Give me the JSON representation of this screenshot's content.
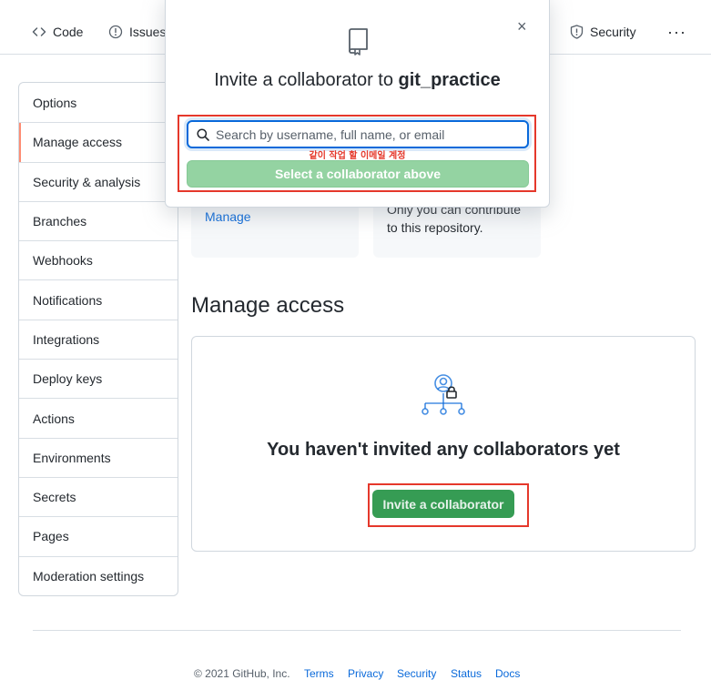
{
  "nav": {
    "code": "Code",
    "issues": "Issues",
    "security": "Security",
    "more": "···"
  },
  "sidebar": {
    "items": [
      {
        "label": "Options"
      },
      {
        "label": "Manage access"
      },
      {
        "label": "Security & analysis"
      },
      {
        "label": "Branches"
      },
      {
        "label": "Webhooks"
      },
      {
        "label": "Notifications"
      },
      {
        "label": "Integrations"
      },
      {
        "label": "Deploy keys"
      },
      {
        "label": "Actions"
      },
      {
        "label": "Environments"
      },
      {
        "label": "Secrets"
      },
      {
        "label": "Pages"
      },
      {
        "label": "Moderation settings"
      }
    ],
    "selected": "Manage access"
  },
  "cards": {
    "manage_link": "Manage",
    "private_text_line1": "Only you can contribute",
    "private_text_line2": "to this repository."
  },
  "manage_access": {
    "title": "Manage access",
    "empty_title": "You haven't invited any collaborators yet",
    "invite_button": "Invite a collaborator"
  },
  "modal": {
    "title_prefix": "Invite a collaborator to ",
    "repo_name": "git_practice",
    "close": "×",
    "search_placeholder": "Search by username, full name, or email",
    "search_value": "",
    "annotation": "같이 작업 할 이메일 계정",
    "select_button": "Select a collaborator above"
  },
  "footer": {
    "copyright": "© 2021 GitHub, Inc.",
    "links": [
      "Terms",
      "Privacy",
      "Security",
      "Status",
      "Docs"
    ]
  },
  "colors": {
    "annotation_red": "#e5382b",
    "invite_green": "#2c974b",
    "disabled_green": "#94d3a2",
    "link_blue": "#0969da",
    "selected_accent": "#fd8c73"
  }
}
